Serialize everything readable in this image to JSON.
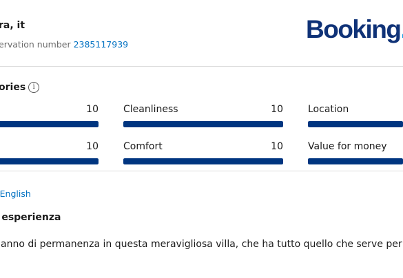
{
  "header": {
    "guest_name": "ra, it",
    "reservation_label": "ervation number",
    "reservation_number": "2385117939",
    "logo_text": "Booking",
    "logo_dot": "."
  },
  "categories": {
    "title": "ories",
    "info_icon": "info-icon",
    "scale_max": 10,
    "items": [
      {
        "label": "",
        "value": "10",
        "fraction": 1.0
      },
      {
        "label": "Cleanliness",
        "value": "10",
        "fraction": 1.0
      },
      {
        "label": "Location",
        "value": "",
        "fraction": 1.0
      },
      {
        "label": "",
        "value": "10",
        "fraction": 1.0
      },
      {
        "label": "Comfort",
        "value": "10",
        "fraction": 1.0
      },
      {
        "label": "Value for money",
        "value": "",
        "fraction": 1.0
      }
    ]
  },
  "review": {
    "translate_link": "o English",
    "title": "a esperienza",
    "text": "o anno di permanenza in questa meravigliosa villa, che ha tutto quello che serve per"
  },
  "colors": {
    "brand_blue": "#003580",
    "link_blue": "#0071c2",
    "logo_blue": "#0f3277",
    "logo_dot": "#0c9ce3"
  }
}
